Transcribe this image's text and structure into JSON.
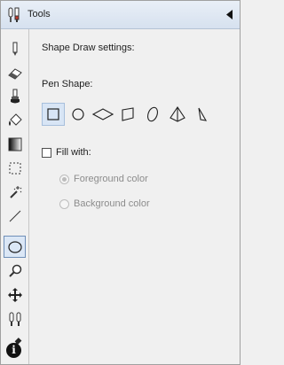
{
  "window": {
    "title": "Tools",
    "title_icon": "tools-icon",
    "collapse_icon": "triangle-left-icon"
  },
  "toolbar": {
    "tools": [
      {
        "icon": "pencil-icon"
      },
      {
        "icon": "eraser-icon"
      },
      {
        "icon": "paint-brush-icon"
      },
      {
        "icon": "paint-bucket-icon"
      },
      {
        "icon": "gradient-icon"
      },
      {
        "icon": "rectangle-select-icon"
      },
      {
        "icon": "magic-wand-icon"
      },
      {
        "icon": "line-icon"
      },
      {
        "icon": "ellipse-icon",
        "selected": true
      },
      {
        "icon": "zoom-icon"
      },
      {
        "icon": "move-icon"
      },
      {
        "icon": "clone-stamp-icon"
      },
      {
        "icon": "color-picker-icon"
      }
    ],
    "info_glyph": "i"
  },
  "settings": {
    "heading": "Shape Draw settings:",
    "pen_shape_label": "Pen Shape:",
    "shapes": [
      "square",
      "circle",
      "diamond",
      "parallelogram",
      "ellipse",
      "pyramid",
      "triangle"
    ],
    "selected_shape": "square",
    "fill_label": "Fill with:",
    "fill_checked": false,
    "fill_options": [
      {
        "label": "Foreground color",
        "checked": true
      },
      {
        "label": "Background color",
        "checked": false
      }
    ]
  }
}
